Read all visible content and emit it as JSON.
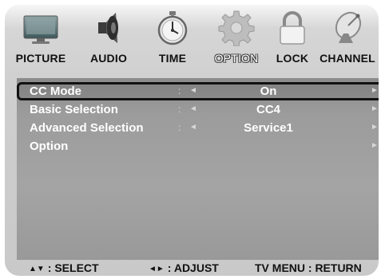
{
  "tabs": [
    {
      "label": "PICTURE",
      "icon": "monitor-icon",
      "active": false
    },
    {
      "label": "AUDIO",
      "icon": "speaker-icon",
      "active": false
    },
    {
      "label": "TIME",
      "icon": "stopwatch-icon",
      "active": false
    },
    {
      "label": "OPTION",
      "icon": "gear-icon",
      "active": true
    },
    {
      "label": "LOCK",
      "icon": "padlock-icon",
      "active": false
    },
    {
      "label": "CHANNEL",
      "icon": "satellite-dish-icon",
      "active": false
    }
  ],
  "menu": {
    "separator": ":",
    "left_arrow": "◄",
    "right_arrow": "►",
    "items": [
      {
        "label": "CC Mode",
        "value": "On",
        "selected": true
      },
      {
        "label": "Basic Selection",
        "value": "CC4",
        "selected": false
      },
      {
        "label": "Advanced Selection",
        "value": "Service1",
        "selected": false
      },
      {
        "label": "Option",
        "value": "",
        "selected": false
      }
    ]
  },
  "footer": {
    "select_glyph": "▲▼",
    "select_label": ": SELECT",
    "adjust_glyph": "◄►",
    "adjust_label": ": ADJUST",
    "return_label": "TV MENU : RETURN"
  },
  "colors": {
    "selection_border": "#111111",
    "menu_text": "#ffffff",
    "panel_bg": "#a0a0a0"
  }
}
